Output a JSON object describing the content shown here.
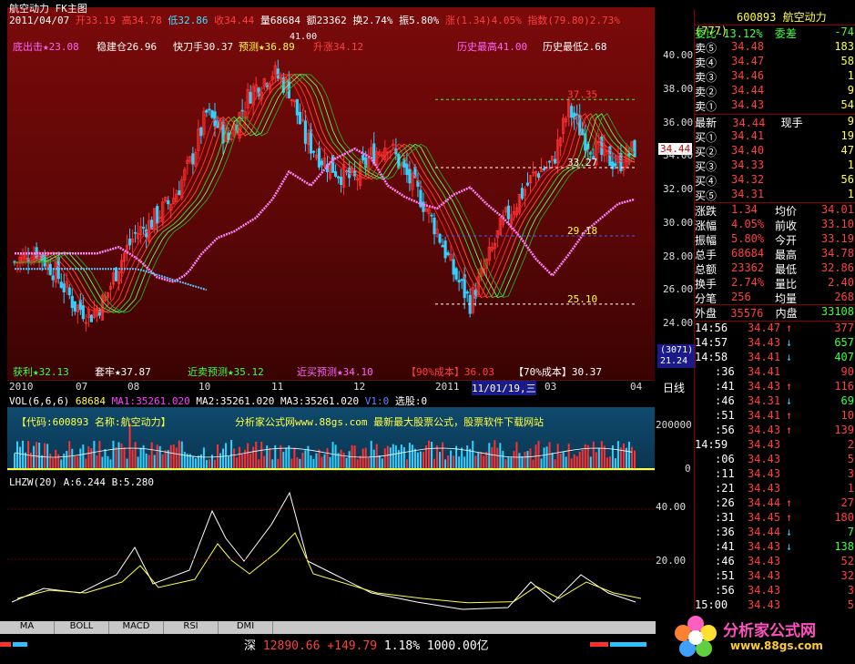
{
  "title": "航空动力 FK主图",
  "header_line": {
    "date": "2011/04/07",
    "open": "开33.19",
    "high": "高34.78",
    "low": "低32.86",
    "close": "收34.44",
    "volume": "量68684",
    "amount": "额23362",
    "turnover": "换2.74%",
    "amplitude": "振5.80%",
    "change": "涨(1.34)4.05%",
    "index": "指数(79.80)2.73%"
  },
  "signals_top": [
    {
      "label": "底出击★23.08",
      "color": "#ff60ff"
    },
    {
      "label": "稳建仓26.96",
      "color": "#ffffff"
    },
    {
      "label": "快刀手30.37",
      "color": "#ffffff"
    },
    {
      "label": "预测★36.89",
      "color": "#ffff40"
    },
    {
      "label": "升涨34.12",
      "color": "#ff4040"
    },
    {
      "label": "历史最高41.00",
      "color": "#ff60ff"
    },
    {
      "label": "历史最低2.68",
      "color": "#ffffff"
    }
  ],
  "signals_bottom": [
    {
      "label": "获利★32.13",
      "color": "#40ff40"
    },
    {
      "label": "套牢★37.87",
      "color": "#ffffff"
    },
    {
      "label": "近卖预测★35.12",
      "color": "#40ff40"
    },
    {
      "label": "近买预测★34.10",
      "color": "#ff60ff"
    },
    {
      "label": "【90%成本】36.03",
      "color": "#ff4040"
    },
    {
      "label": "【70%成本】30.37",
      "color": "#ffffff"
    }
  ],
  "price_axis": [
    "40.00",
    "38.00",
    "36.00",
    "34.00",
    "32.00",
    "30.00",
    "28.00",
    "26.00",
    "24.00"
  ],
  "price_labels": {
    "high_mark": "37.35",
    "mid_mark": "33.27",
    "level1": "29.18",
    "level2": "25.10",
    "peak": "41.00",
    "current": "34.44"
  },
  "cursor_info": {
    "count": "(3071)",
    "price": "21.24"
  },
  "time_axis": [
    "2010",
    "07",
    "08",
    "10",
    "11",
    "12",
    "2011",
    "11/01/19,三",
    "03",
    "04"
  ],
  "period_label": "日线",
  "vol_header": {
    "name": "VOL(6,6,6)",
    "v": "68684",
    "ma1": "MA1:35261.020",
    "ma2": "MA2:35261.020",
    "ma3": "MA3:35261.020",
    "v1": "V1:0",
    "pick": "选股:0"
  },
  "vol_banner": "【代码:600893 名称:航空动力】",
  "vol_site": "分析家公式网www.88gs.com 最新最大股票公式，股票软件下载网站",
  "vol_axis": [
    "200000",
    "0"
  ],
  "ind_header": {
    "name": "LHZW(20)",
    "a": "A:6.244",
    "b": "B:5.280"
  },
  "ind_axis": [
    "40.00",
    "20.00"
  ],
  "tabs": [
    "MA",
    "BOLL",
    "MACD",
    "RSI",
    "DMI"
  ],
  "status": {
    "market": "深",
    "index": "12890.66",
    "change": "+149.79",
    "pct": "1.18%",
    "amount": "1000.00亿"
  },
  "brand": {
    "name": "分析家公式网",
    "url": "www.88gs.com"
  },
  "side": {
    "code": "600893",
    "name": "航空动力(777)",
    "weibi": "委比-13.12%",
    "weicha": "委差",
    "weicha_val": "-74",
    "sells": [
      {
        "label": "卖⑤",
        "price": "34.48",
        "vol": "183"
      },
      {
        "label": "卖④",
        "price": "34.47",
        "vol": "58"
      },
      {
        "label": "卖③",
        "price": "34.46",
        "vol": "1"
      },
      {
        "label": "卖②",
        "price": "34.44",
        "vol": "9"
      },
      {
        "label": "卖①",
        "price": "34.43",
        "vol": "54"
      }
    ],
    "latest_label": "最新",
    "latest": "34.44",
    "hand_label": "现手",
    "hand": "9",
    "buys": [
      {
        "label": "买①",
        "price": "34.41",
        "vol": "19"
      },
      {
        "label": "买②",
        "price": "34.40",
        "vol": "47"
      },
      {
        "label": "买③",
        "price": "34.33",
        "vol": "1"
      },
      {
        "label": "买④",
        "price": "34.32",
        "vol": "56"
      },
      {
        "label": "买⑤",
        "price": "34.31",
        "vol": "1"
      }
    ],
    "stats": [
      {
        "l1": "涨跌",
        "v1": "1.34",
        "l2": "均价",
        "v2": "34.01"
      },
      {
        "l1": "涨幅",
        "v1": "4.05%",
        "l2": "前收",
        "v2": "33.10"
      },
      {
        "l1": "振幅",
        "v1": "5.80%",
        "l2": "今开",
        "v2": "33.19"
      },
      {
        "l1": "总手",
        "v1": "68684",
        "l2": "最高",
        "v2": "34.78"
      },
      {
        "l1": "总额",
        "v1": "23362",
        "l2": "最低",
        "v2": "32.86"
      },
      {
        "l1": "换手",
        "v1": "2.74%",
        "l2": "量比",
        "v2": "2.40"
      },
      {
        "l1": "分笔",
        "v1": "256",
        "l2": "均量",
        "v2": "268"
      }
    ],
    "outer_label": "外盘",
    "outer": "35576",
    "inner_label": "内盘",
    "inner": "33108",
    "ticks": [
      {
        "t": "14:56",
        "p": "34.47",
        "d": "↑",
        "v": "377"
      },
      {
        "t": "14:57",
        "p": "34.43",
        "d": "↓",
        "v": "657"
      },
      {
        "t": "14:58",
        "p": "34.41",
        "d": "↓",
        "v": "407"
      },
      {
        "t": ":36",
        "p": "34.41",
        "d": "",
        "v": "90"
      },
      {
        "t": ":41",
        "p": "34.43",
        "d": "↑",
        "v": "116"
      },
      {
        "t": ":46",
        "p": "34.31",
        "d": "↓",
        "v": "69"
      },
      {
        "t": ":51",
        "p": "34.41",
        "d": "↑",
        "v": "10"
      },
      {
        "t": ":56",
        "p": "34.43",
        "d": "↑",
        "v": "139"
      },
      {
        "t": "14:59",
        "p": "34.43",
        "d": "",
        "v": "2"
      },
      {
        "t": ":06",
        "p": "34.43",
        "d": "",
        "v": "5"
      },
      {
        "t": ":11",
        "p": "34.43",
        "d": "",
        "v": "3"
      },
      {
        "t": ":21",
        "p": "34.43",
        "d": "",
        "v": "1"
      },
      {
        "t": ":26",
        "p": "34.44",
        "d": "↑",
        "v": "27"
      },
      {
        "t": ":31",
        "p": "34.45",
        "d": "↑",
        "v": "180"
      },
      {
        "t": ":36",
        "p": "34.44",
        "d": "↓",
        "v": "7"
      },
      {
        "t": ":41",
        "p": "34.43",
        "d": "↓",
        "v": "138"
      },
      {
        "t": ":46",
        "p": "34.43",
        "d": "",
        "v": "52"
      },
      {
        "t": ":51",
        "p": "34.43",
        "d": "",
        "v": "32"
      },
      {
        "t": ":56",
        "p": "34.43",
        "d": "",
        "v": "3"
      },
      {
        "t": "15:00",
        "p": "34.43",
        "d": "",
        "v": "5"
      }
    ]
  }
}
